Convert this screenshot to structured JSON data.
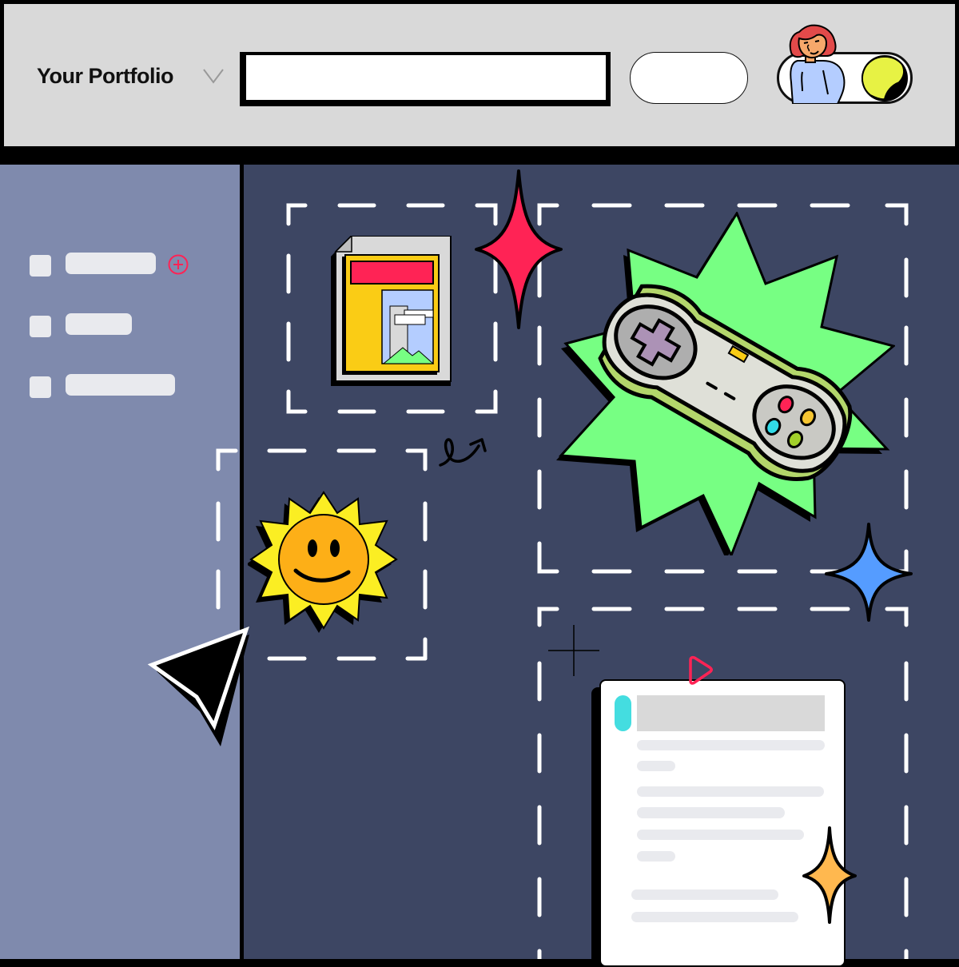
{
  "header": {
    "brand": "Your Portfolio",
    "brand_dropdown_icon": "chevron-down-icon",
    "search": {
      "value": "",
      "placeholder": ""
    },
    "action_button_label": "",
    "profile_toggle": {
      "state": "on",
      "icons": [
        "avatar-woman-red-hair",
        "yellow-knob"
      ]
    }
  },
  "sidebar": {
    "items": [
      {
        "label": "",
        "icon": "square-icon",
        "has_add": true
      },
      {
        "label": "",
        "icon": "square-icon",
        "has_add": false
      },
      {
        "label": "",
        "icon": "square-icon",
        "has_add": false
      }
    ],
    "add_icon": "plus-circle-icon"
  },
  "canvas": {
    "stickers": [
      {
        "name": "document-image-sticker",
        "icon": "document-with-image-icon"
      },
      {
        "name": "sun-smiley-sticker",
        "icon": "smiling-sun-icon"
      },
      {
        "name": "game-controller-sticker",
        "icon": "gamepad-icon"
      },
      {
        "name": "content-card-sticker",
        "icon": "text-card-icon"
      }
    ],
    "decorations": [
      "red-sparkle-icon",
      "blue-sparkle-icon",
      "orange-sparkle-icon",
      "curly-arrow-icon",
      "crosshair-icon",
      "play-icon",
      "cursor-arrow-icon"
    ],
    "colors": {
      "sidebar_bg": "#7f8aad",
      "canvas_bg": "#3d4663",
      "header_bg": "#d9d9d9",
      "accent_red": "#ff2355",
      "accent_green": "#77ff83",
      "accent_blue": "#559cff",
      "accent_orange": "#ffb84f",
      "accent_cyan": "#44dde0",
      "accent_yellow": "#e7f244"
    }
  }
}
